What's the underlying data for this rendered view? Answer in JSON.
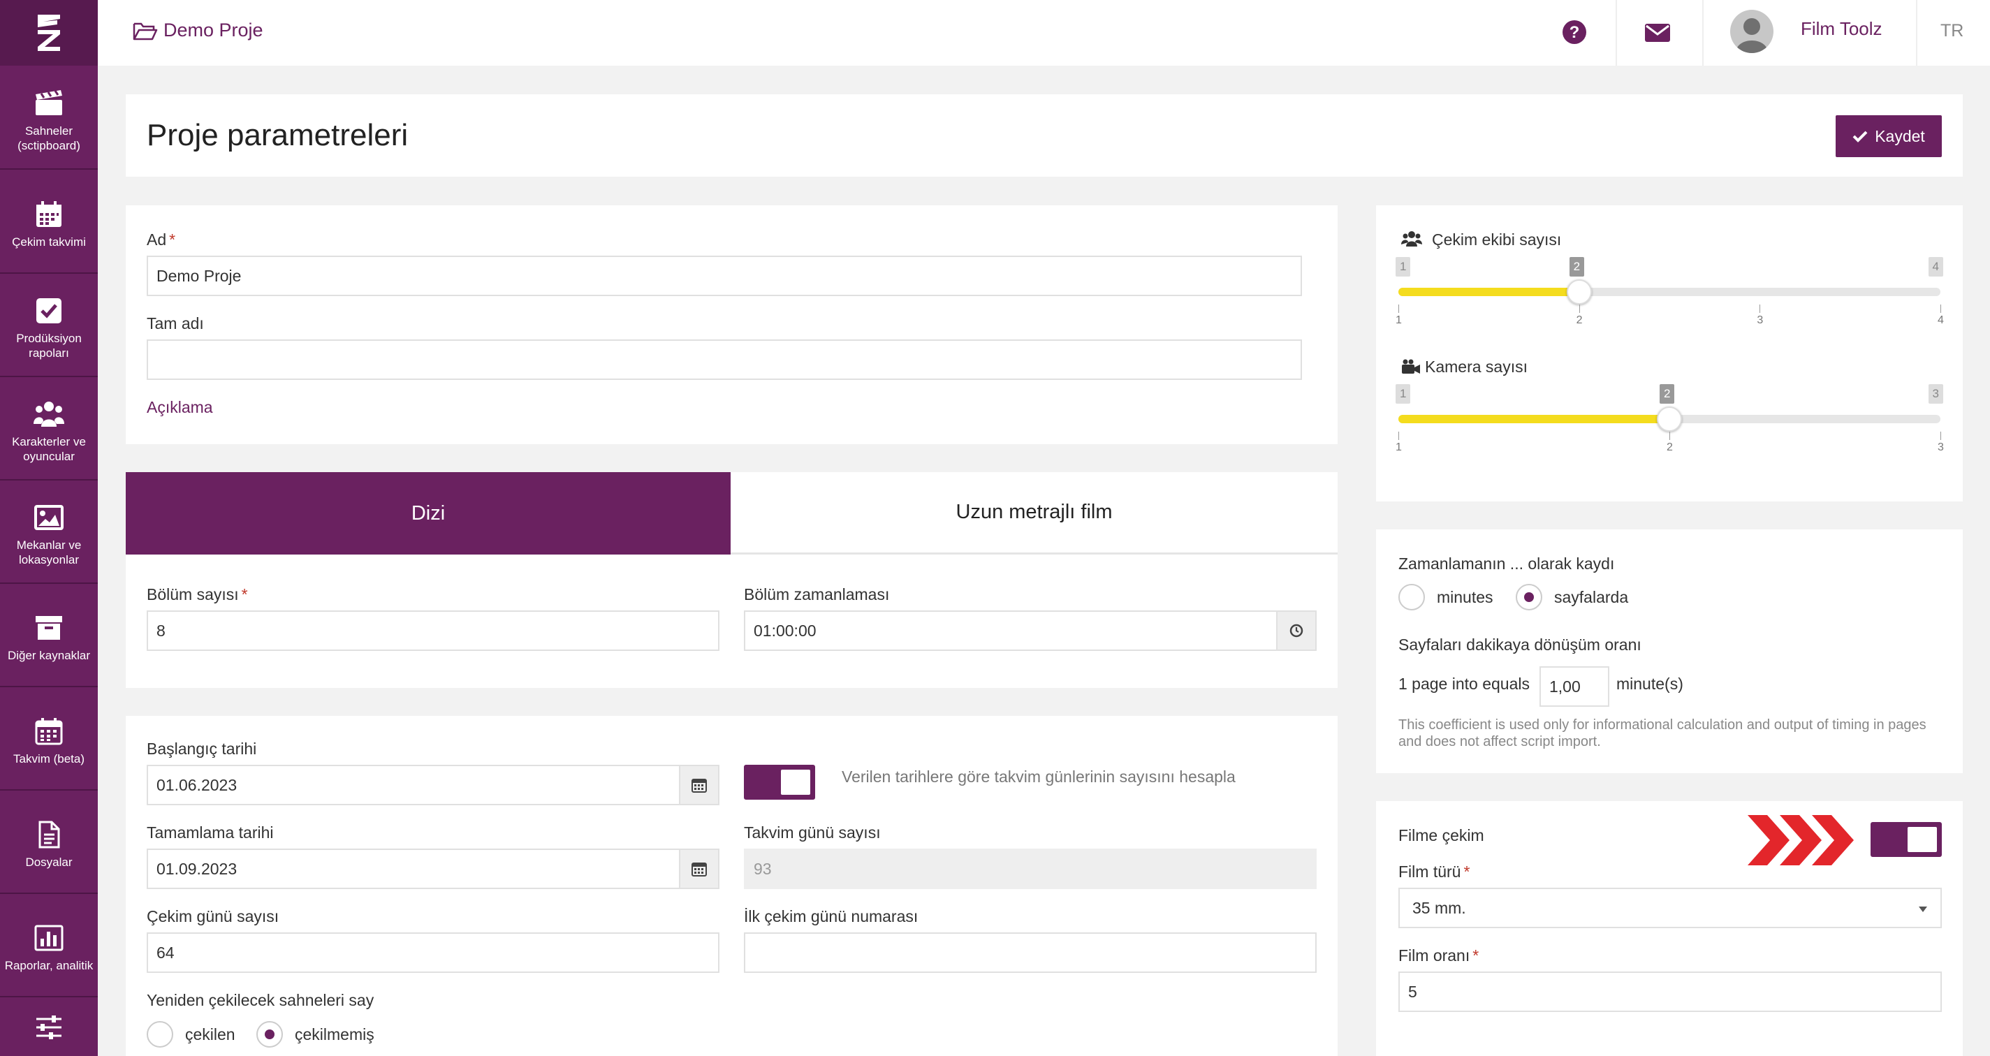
{
  "colors": {
    "brand": "#6a2160",
    "slider_fill": "#f4dc1e",
    "chevrons": "#e3262b"
  },
  "sidebar": {
    "logo_icon": "z-logo-icon",
    "items": [
      {
        "label": "Sahneler (sctipboard)",
        "icon": "clapperboard-icon"
      },
      {
        "label": "Çekim takvimi",
        "icon": "calendar-icon"
      },
      {
        "label": "Prodüksiyon rapoları",
        "icon": "checkbox-icon"
      },
      {
        "label": "Karakterler ve oyuncular",
        "icon": "users-icon"
      },
      {
        "label": "Mekanlar ve lokasyonlar",
        "icon": "image-icon"
      },
      {
        "label": "Diğer kaynaklar",
        "icon": "archive-icon"
      },
      {
        "label": "Takvim (beta)",
        "icon": "calendar-grid-icon"
      },
      {
        "label": "Dosyalar",
        "icon": "file-icon"
      },
      {
        "label": "Raporlar, analitik",
        "icon": "bar-chart-icon"
      },
      {
        "label": "",
        "icon": "sliders-icon"
      }
    ]
  },
  "header": {
    "project": "Demo Proje",
    "user": "Film Toolz",
    "lang": "TR"
  },
  "page": {
    "title": "Proje parametreleri",
    "save_label": "Kaydet"
  },
  "basic": {
    "name_label": "Ad",
    "name_value": "Demo Proje",
    "fullname_label": "Tam adı",
    "fullname_value": "",
    "description_link": "Açıklama"
  },
  "tabs": {
    "series": "Dizi",
    "feature": "Uzun metrajlı film"
  },
  "series": {
    "episodes_label": "Bölüm sayısı",
    "episodes_value": "8",
    "timing_label": "Bölüm zamanlaması",
    "timing_value": "01:00:00"
  },
  "schedule": {
    "start_label": "Başlangıç tarihi",
    "start_value": "01.06.2023",
    "toggle_label": "Verilen tarihlere göre takvim günlerinin sayısını hesapla",
    "end_label": "Tamamlama tarihi",
    "end_value": "01.09.2023",
    "calendar_days_label": "Takvim günü sayısı",
    "calendar_days_value": "93",
    "shoot_days_label": "Çekim günü sayısı",
    "shoot_days_value": "64",
    "first_day_label": "İlk çekim günü numarası",
    "first_day_value": "",
    "reshoot_label": "Yeniden çekilecek sahneleri say",
    "reshoot_options": [
      "çekilen",
      "çekilmemiş"
    ]
  },
  "crew": {
    "crew_label": "Çekim ekibi sayısı",
    "crew_min": 1,
    "crew_max": 4,
    "crew_value": 2,
    "crew_ticks": [
      "1",
      "2",
      "3",
      "4"
    ],
    "camera_label": "Kamera sayısı",
    "camera_min": 1,
    "camera_max": 3,
    "camera_value": 2,
    "camera_ticks": [
      "1",
      "2",
      "3"
    ]
  },
  "timing": {
    "label": "Zamanlamanın ... olarak kaydı",
    "options": [
      "minutes",
      "sayfalarda"
    ],
    "ratio_label": "Sayfaları dakikaya dönüşüm oranı",
    "ratio_prefix": "1 page into equals",
    "ratio_value": "1,00",
    "ratio_suffix": "minute(s)",
    "note": "This coefficient is used only for informational calculation and output of timing in pages and does not affect script import."
  },
  "film": {
    "label": "Filme çekim",
    "type_label": "Film türü",
    "type_value": "35 mm.",
    "ratio_label": "Film oranı",
    "ratio_value": "5"
  }
}
